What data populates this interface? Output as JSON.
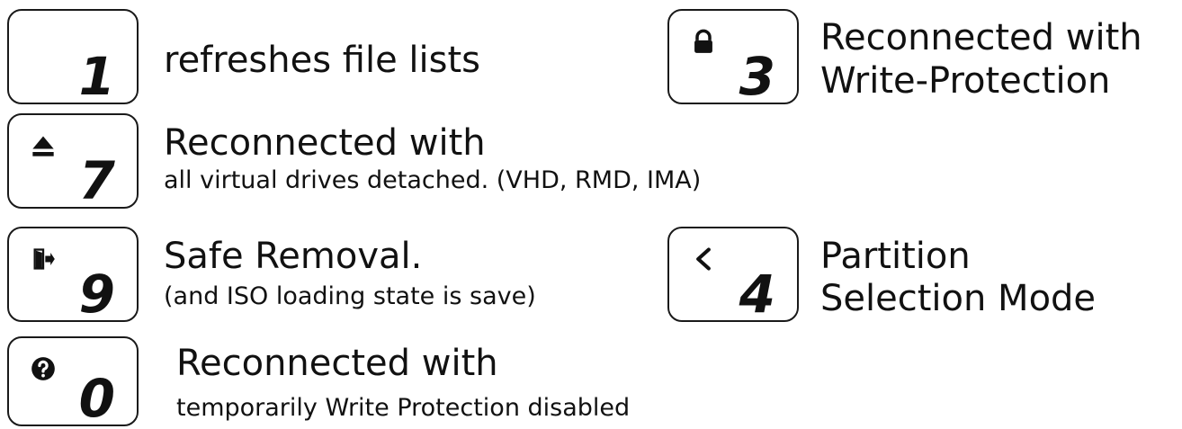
{
  "legend": [
    {
      "key": "1",
      "icon": "",
      "title": "refreshes file lists",
      "subtitle": ""
    },
    {
      "key": "3",
      "icon": "lock-icon",
      "title": "Reconnected with",
      "subtitle": "Write-Protection"
    },
    {
      "key": "7",
      "icon": "eject-icon",
      "title": "Reconnected with",
      "subtitle": "all virtual drives detached. (VHD, RMD, IMA)"
    },
    {
      "key": "9",
      "icon": "exit-door-icon",
      "title": "Safe Removal.",
      "subtitle": "(and ISO loading state is save)"
    },
    {
      "key": "4",
      "icon": "chevron-left-icon",
      "title": "Partition",
      "subtitle": "Selection Mode"
    },
    {
      "key": "0",
      "icon": "question-circle-icon",
      "title": "Reconnected with",
      "subtitle": "temporarily Write Protection disabled"
    }
  ]
}
